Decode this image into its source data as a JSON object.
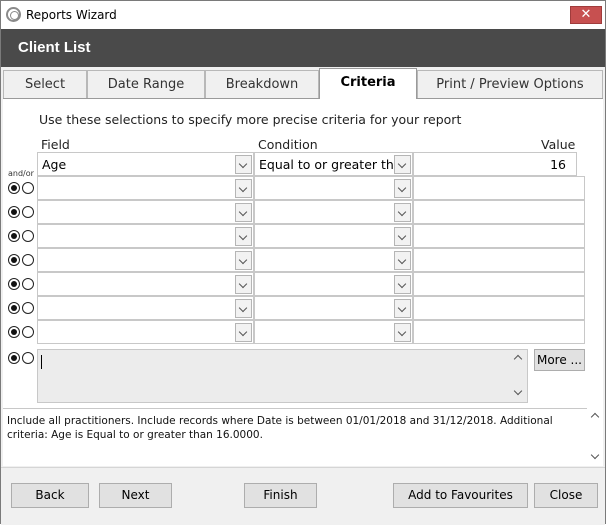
{
  "window": {
    "title": "Reports Wizard",
    "close_glyph": "✕"
  },
  "header": {
    "title": "Client List"
  },
  "tabs": [
    {
      "label": "Select"
    },
    {
      "label": "Date Range"
    },
    {
      "label": "Breakdown"
    },
    {
      "label": "Criteria",
      "active": true
    },
    {
      "label": "Print / Preview Options"
    }
  ],
  "criteria": {
    "instruction": "Use these selections to specify more precise criteria for your report",
    "headers": {
      "field": "Field",
      "condition": "Condition",
      "value": "Value"
    },
    "andor_label": "and/or",
    "first_row": {
      "field": "Age",
      "condition": "Equal to or greater tha",
      "value": "16"
    },
    "rows": [
      {
        "field": "",
        "condition": "",
        "value": "",
        "and_selected": true
      },
      {
        "field": "",
        "condition": "",
        "value": "",
        "and_selected": true
      },
      {
        "field": "",
        "condition": "",
        "value": "",
        "and_selected": true
      },
      {
        "field": "",
        "condition": "",
        "value": "",
        "and_selected": true
      },
      {
        "field": "",
        "condition": "",
        "value": "",
        "and_selected": true
      },
      {
        "field": "",
        "condition": "",
        "value": "",
        "and_selected": true
      },
      {
        "field": "",
        "condition": "",
        "value": "",
        "and_selected": true
      }
    ],
    "more_button": "More ..."
  },
  "summary": {
    "text": "Include all practitioners. Include records where Date is between 01/01/2018 and 31/12/2018. Additional criteria: Age is Equal to or greater than 16.0000."
  },
  "footer": {
    "back": "Back",
    "next": "Next",
    "finish": "Finish",
    "add_favourites": "Add to Favourites",
    "close": "Close"
  },
  "icons": {
    "app": "app-logo-icon",
    "dropdown": "chevron-down-icon",
    "scroll_up": "chevron-up-icon",
    "scroll_down": "chevron-down-icon"
  },
  "colors": {
    "header_band": "#4a4a4a",
    "close_button": "#c75050",
    "panel": "#ffffff",
    "memo": "#ececec"
  }
}
